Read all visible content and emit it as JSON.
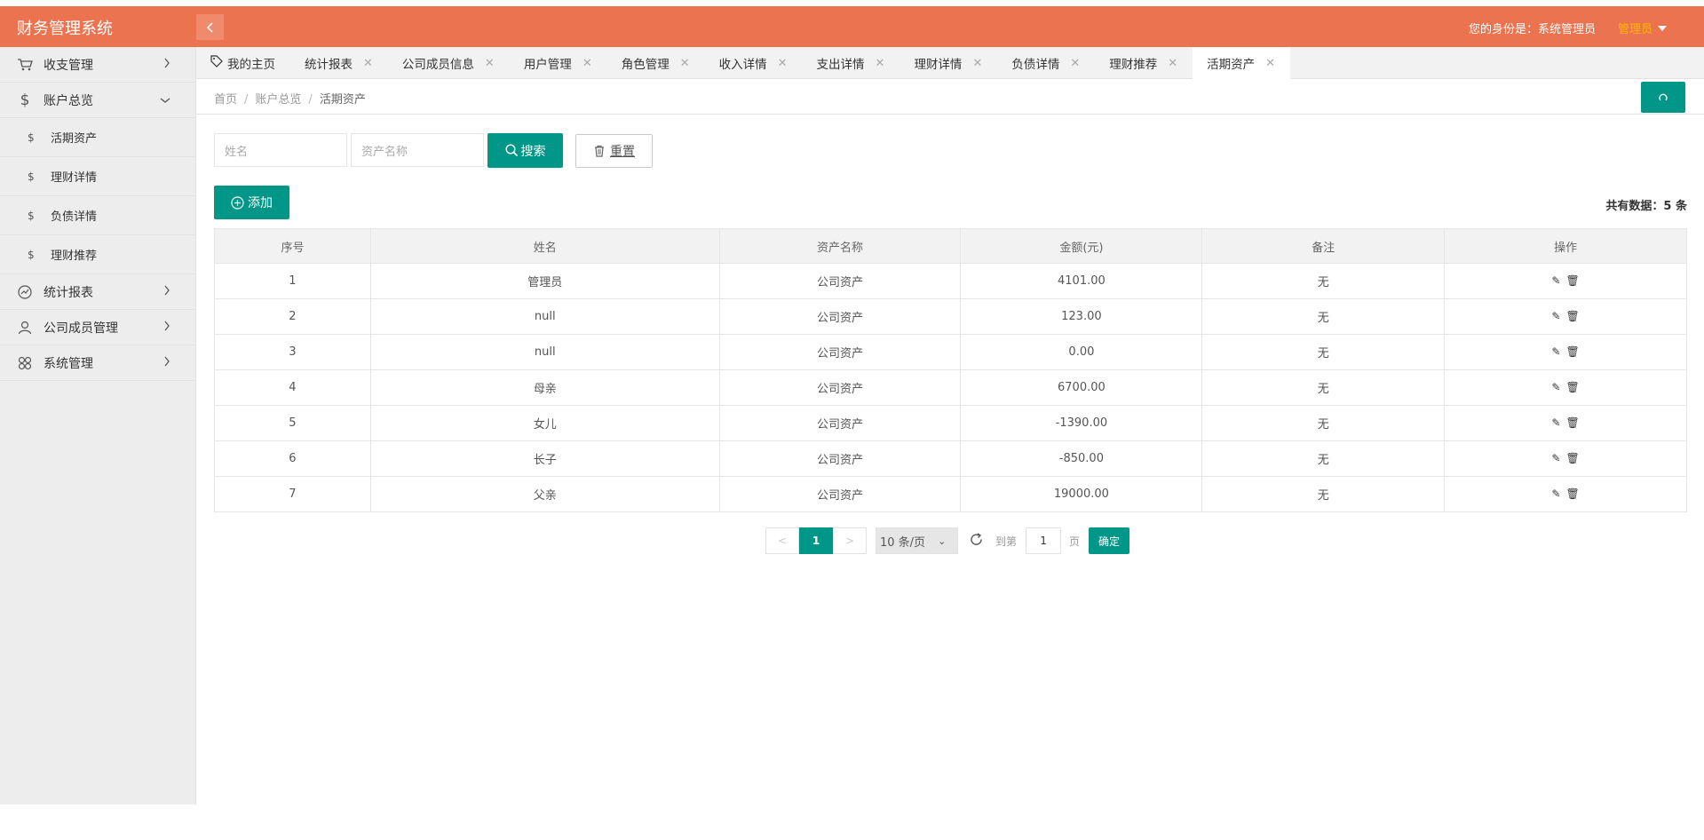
{
  "header": {
    "app_title": "财务管理系统",
    "identity_text": "您的身份是：系统管理员",
    "user_name": "管理员"
  },
  "sidebar": {
    "items": [
      {
        "label": "收支管理",
        "icon": "cart-icon"
      },
      {
        "label": "账户总览",
        "icon": "dollar-icon",
        "expanded": true,
        "children": [
          "活期资产",
          "理财详情",
          "负债详情",
          "理财推荐"
        ]
      },
      {
        "label": "统计报表",
        "icon": "chart-line-icon"
      },
      {
        "label": "公司成员管理",
        "icon": "users-icon"
      },
      {
        "label": "系统管理",
        "icon": "apps-icon"
      }
    ]
  },
  "tabs": [
    {
      "label": "我的主页",
      "closable": false
    },
    {
      "label": "统计报表",
      "closable": true
    },
    {
      "label": "公司成员信息",
      "closable": true
    },
    {
      "label": "用户管理",
      "closable": true
    },
    {
      "label": "角色管理",
      "closable": true
    },
    {
      "label": "收入详情",
      "closable": true
    },
    {
      "label": "支出详情",
      "closable": true
    },
    {
      "label": "理财详情",
      "closable": true
    },
    {
      "label": "负债详情",
      "closable": true
    },
    {
      "label": "理财推荐",
      "closable": true
    },
    {
      "label": "活期资产",
      "closable": true,
      "active": true
    }
  ],
  "breadcrumb": [
    "首页",
    "账户总览",
    "活期资产"
  ],
  "search": {
    "name_placeholder": "姓名",
    "asset_placeholder": "资产名称",
    "search_label": "搜索",
    "reset_label": "重置"
  },
  "toolbar": {
    "add_label": "添加",
    "total_text": "共有数据：5 条"
  },
  "table": {
    "columns": [
      "序号",
      "姓名",
      "资产名称",
      "金额(元)",
      "备注",
      "操作"
    ],
    "rows": [
      [
        "1",
        "管理员",
        "公司资产",
        "4101.00",
        "无"
      ],
      [
        "2",
        "null",
        "公司资产",
        "123.00",
        "无"
      ],
      [
        "3",
        "null",
        "公司资产",
        "0.00",
        "无"
      ],
      [
        "4",
        "母亲",
        "公司资产",
        "6700.00",
        "无"
      ],
      [
        "5",
        "女儿",
        "公司资产",
        "-1390.00",
        "无"
      ],
      [
        "6",
        "长子",
        "公司资产",
        "-850.00",
        "无"
      ],
      [
        "7",
        "父亲",
        "公司资产",
        "19000.00",
        "无"
      ]
    ]
  },
  "pager": {
    "prev": "<",
    "current": "1",
    "next": ">",
    "page_size": "10 条/页",
    "goto_label": "到第",
    "goto_value": "1",
    "page_label": "页",
    "ok_label": "确定"
  },
  "colors": {
    "header": "#ec7350",
    "primary": "#009688",
    "user_name": "#ffb800"
  }
}
